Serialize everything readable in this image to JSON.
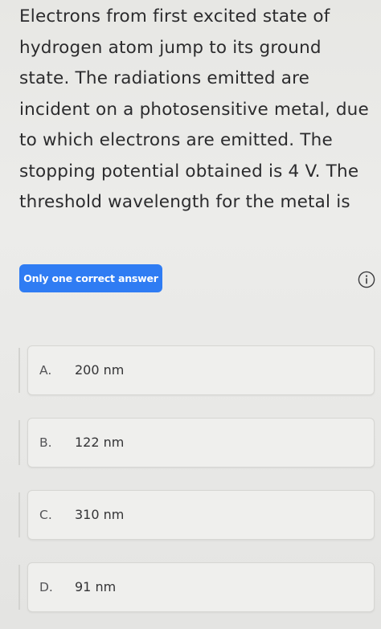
{
  "question": {
    "text": "Electrons from first excited state of\nhydrogen atom jump to its ground\nstate. The radiations emitted are\nincident on a photosensitive metal, due\nto which electrons are emitted. The\nstopping potential obtained is 4 V. The\nthreshold wavelength for the metal is"
  },
  "badge": {
    "label": "Only one correct answer"
  },
  "info": {
    "icon": "info-icon"
  },
  "options": [
    {
      "letter": "A.",
      "text": "200 nm"
    },
    {
      "letter": "B.",
      "text": "122 nm"
    },
    {
      "letter": "C.",
      "text": "310 nm"
    },
    {
      "letter": "D.",
      "text": "91 nm"
    }
  ],
  "colors": {
    "accent": "#2f7cf3",
    "background": "#e9e9e7",
    "text": "#2b2b2d"
  }
}
